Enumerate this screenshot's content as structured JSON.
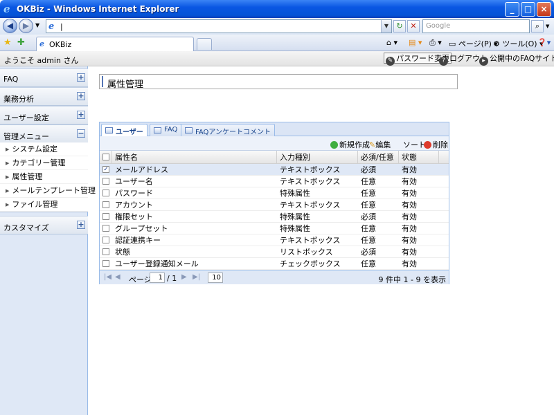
{
  "window": {
    "title": "OKBiz - Windows Internet Explorer",
    "minimize": "_",
    "maximize": "□",
    "close": "×"
  },
  "browser": {
    "address_value": "|",
    "search_placeholder": "Google",
    "tab_label": "OKBiz",
    "page_menu": "ページ(P)",
    "tools_menu": "ツール(O)"
  },
  "header": {
    "welcome": "ようこそ admin さん",
    "change_password": "パスワード変更",
    "logout": "ログアウト",
    "public_faq": "公開中のFAQサイトへ"
  },
  "sidebar": {
    "sections": [
      {
        "label": "FAQ",
        "toggle": "+"
      },
      {
        "label": "業務分析",
        "toggle": "+"
      },
      {
        "label": "ユーザー設定",
        "toggle": "+"
      },
      {
        "label": "管理メニュー",
        "toggle": "−"
      },
      {
        "label": "カスタマイズ",
        "toggle": "+"
      }
    ],
    "submenu": [
      "システム設定",
      "カテゴリー管理",
      "属性管理",
      "メールテンプレート管理",
      "ファイル管理"
    ]
  },
  "main": {
    "page_title": "属性管理",
    "tabs": [
      "ユーザー",
      "FAQ",
      "FAQアンケートコメント"
    ],
    "toolbar": {
      "new": "新規作成",
      "edit": "編集",
      "sort": "ソート",
      "delete": "削除"
    },
    "columns": [
      "属性名",
      "入力種別",
      "必須/任意",
      "状態"
    ],
    "rows": [
      {
        "checked": true,
        "name": "メールアドレス",
        "type": "テキストボックス",
        "required": "必須",
        "status": "有効"
      },
      {
        "checked": false,
        "name": "ユーザー名",
        "type": "テキストボックス",
        "required": "任意",
        "status": "有効"
      },
      {
        "checked": false,
        "name": "パスワード",
        "type": "特殊属性",
        "required": "任意",
        "status": "有効"
      },
      {
        "checked": false,
        "name": "アカウント",
        "type": "テキストボックス",
        "required": "任意",
        "status": "有効"
      },
      {
        "checked": false,
        "name": "権限セット",
        "type": "特殊属性",
        "required": "必須",
        "status": "有効"
      },
      {
        "checked": false,
        "name": "グループセット",
        "type": "特殊属性",
        "required": "任意",
        "status": "有効"
      },
      {
        "checked": false,
        "name": "認証連携キー",
        "type": "テキストボックス",
        "required": "任意",
        "status": "有効"
      },
      {
        "checked": false,
        "name": "状態",
        "type": "リストボックス",
        "required": "必須",
        "status": "有効"
      },
      {
        "checked": false,
        "name": "ユーザー登録通知メール",
        "type": "チェックボックス",
        "required": "任意",
        "status": "有効"
      }
    ],
    "pager": {
      "page_label": "ページ",
      "page": "1",
      "of": "/ 1",
      "page_size": "10",
      "summary": "9 件中 1 - 9 を表示"
    }
  }
}
